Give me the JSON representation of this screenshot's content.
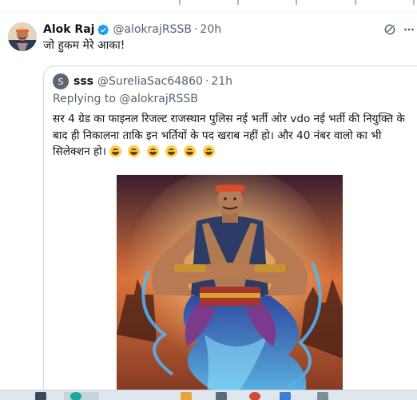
{
  "tweet": {
    "author_name": "Alok Raj",
    "author_handle": "@alokrajRSSB",
    "separator": "·",
    "time": "20h",
    "text": "जो हुकम मेरे आका!"
  },
  "quoted_tweet": {
    "avatar_letter": "S",
    "author_name": "sss",
    "author_handle": "@SureliaSac64860",
    "separator": "·",
    "time": "21h",
    "replying_to_label": "Replying to",
    "replying_to_handle": "@alokrajRSSB",
    "text": "सर 4 ग्रेड का फाइनल रिजल्ट राजस्थान पुलिस  नई भर्ती ओर vdo नई भर्ती की नियुक्ति के बाद ही निकालना ताकि इन भर्तियों के पद खराब नहीं हो। और 40 नंबर वालो का भी सिलेक्शन हो।",
    "emoji_count": 6,
    "emoji_icon": "grinning-face-icon",
    "image_description_icon": "genie-illustration"
  },
  "colors": {
    "text_primary": "#0f1419",
    "text_secondary": "#536471",
    "verified_blue": "#1d9bf0",
    "border": "#cfd9de"
  }
}
